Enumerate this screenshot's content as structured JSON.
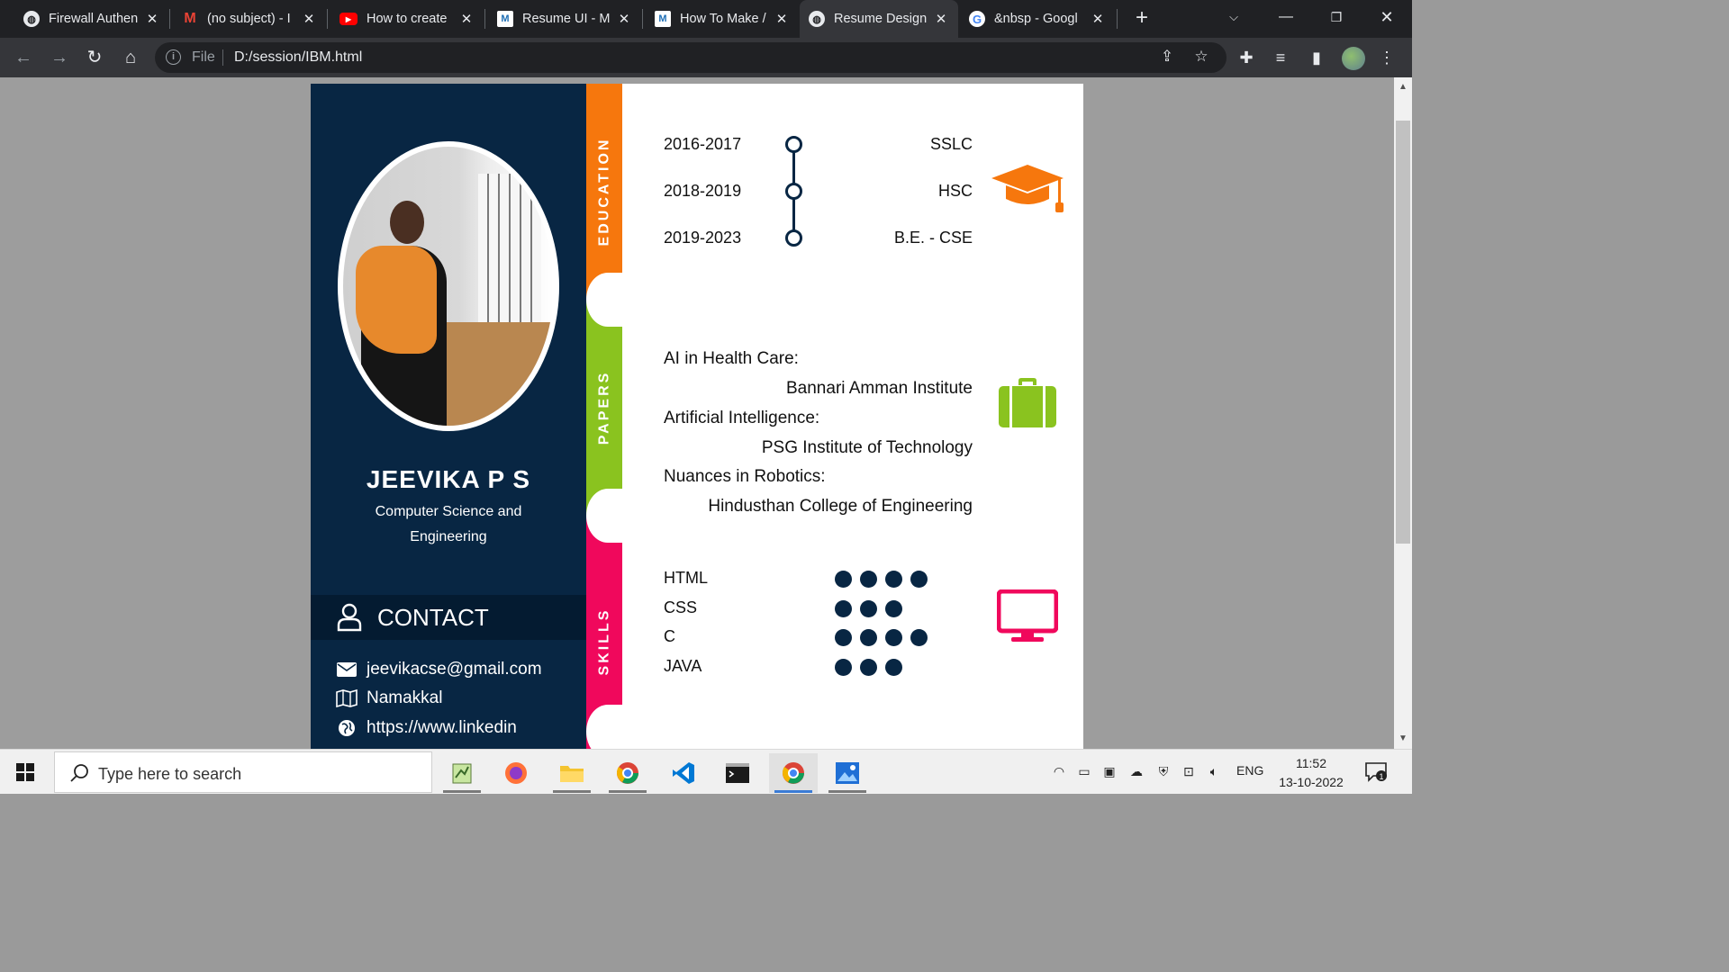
{
  "browser": {
    "tabs": [
      {
        "title": "Firewall Authen",
        "icon": "globe-icon",
        "active": false
      },
      {
        "title": "(no subject) - I",
        "icon": "gmail-icon",
        "active": false
      },
      {
        "title": "How to create",
        "icon": "youtube-icon",
        "active": false
      },
      {
        "title": "Resume UI - M",
        "icon": "m-icon",
        "active": false
      },
      {
        "title": "How To Make /",
        "icon": "m-icon",
        "active": false
      },
      {
        "title": "Resume Design",
        "icon": "globe-icon",
        "active": true
      },
      {
        "title": "&nbsp - Googl",
        "icon": "google-icon",
        "active": false
      }
    ],
    "address": {
      "scheme": "File",
      "url": "D:/session/IBM.html"
    }
  },
  "resume": {
    "name": "JEEVIKA P S",
    "department": "Computer Science and Engineering",
    "contact": {
      "heading": "CONTACT",
      "email": "jeevikacse@gmail.com",
      "location": "Namakkal",
      "website": "https://www.linkedin"
    },
    "sections": {
      "education_label": "EDUCATION",
      "papers_label": "PAPERS",
      "skills_label": "SKILLS"
    },
    "education": [
      {
        "years": "2016-2017",
        "degree": "SSLC"
      },
      {
        "years": "2018-2019",
        "degree": "HSC"
      },
      {
        "years": "2019-2023",
        "degree": "B.E. - CSE"
      }
    ],
    "papers": [
      {
        "title": "AI in Health Care:",
        "institute": "Bannari Amman Institute"
      },
      {
        "title": "Artificial Intelligence:",
        "institute": "PSG Institute of Technology"
      },
      {
        "title": "Nuances in Robotics:",
        "institute": "Hindusthan College of Engineering"
      }
    ],
    "skills": [
      {
        "name": "HTML",
        "level": 4
      },
      {
        "name": "CSS",
        "level": 3
      },
      {
        "name": "C",
        "level": 4
      },
      {
        "name": "JAVA",
        "level": 3
      }
    ],
    "colors": {
      "navy": "#082643",
      "education": "#f6770d",
      "papers": "#8ac31f",
      "skills": "#f0085c"
    }
  },
  "taskbar": {
    "search_placeholder": "Type here to search",
    "language": "ENG",
    "time": "11:52",
    "date": "13-10-2022",
    "notification_count": "1"
  }
}
